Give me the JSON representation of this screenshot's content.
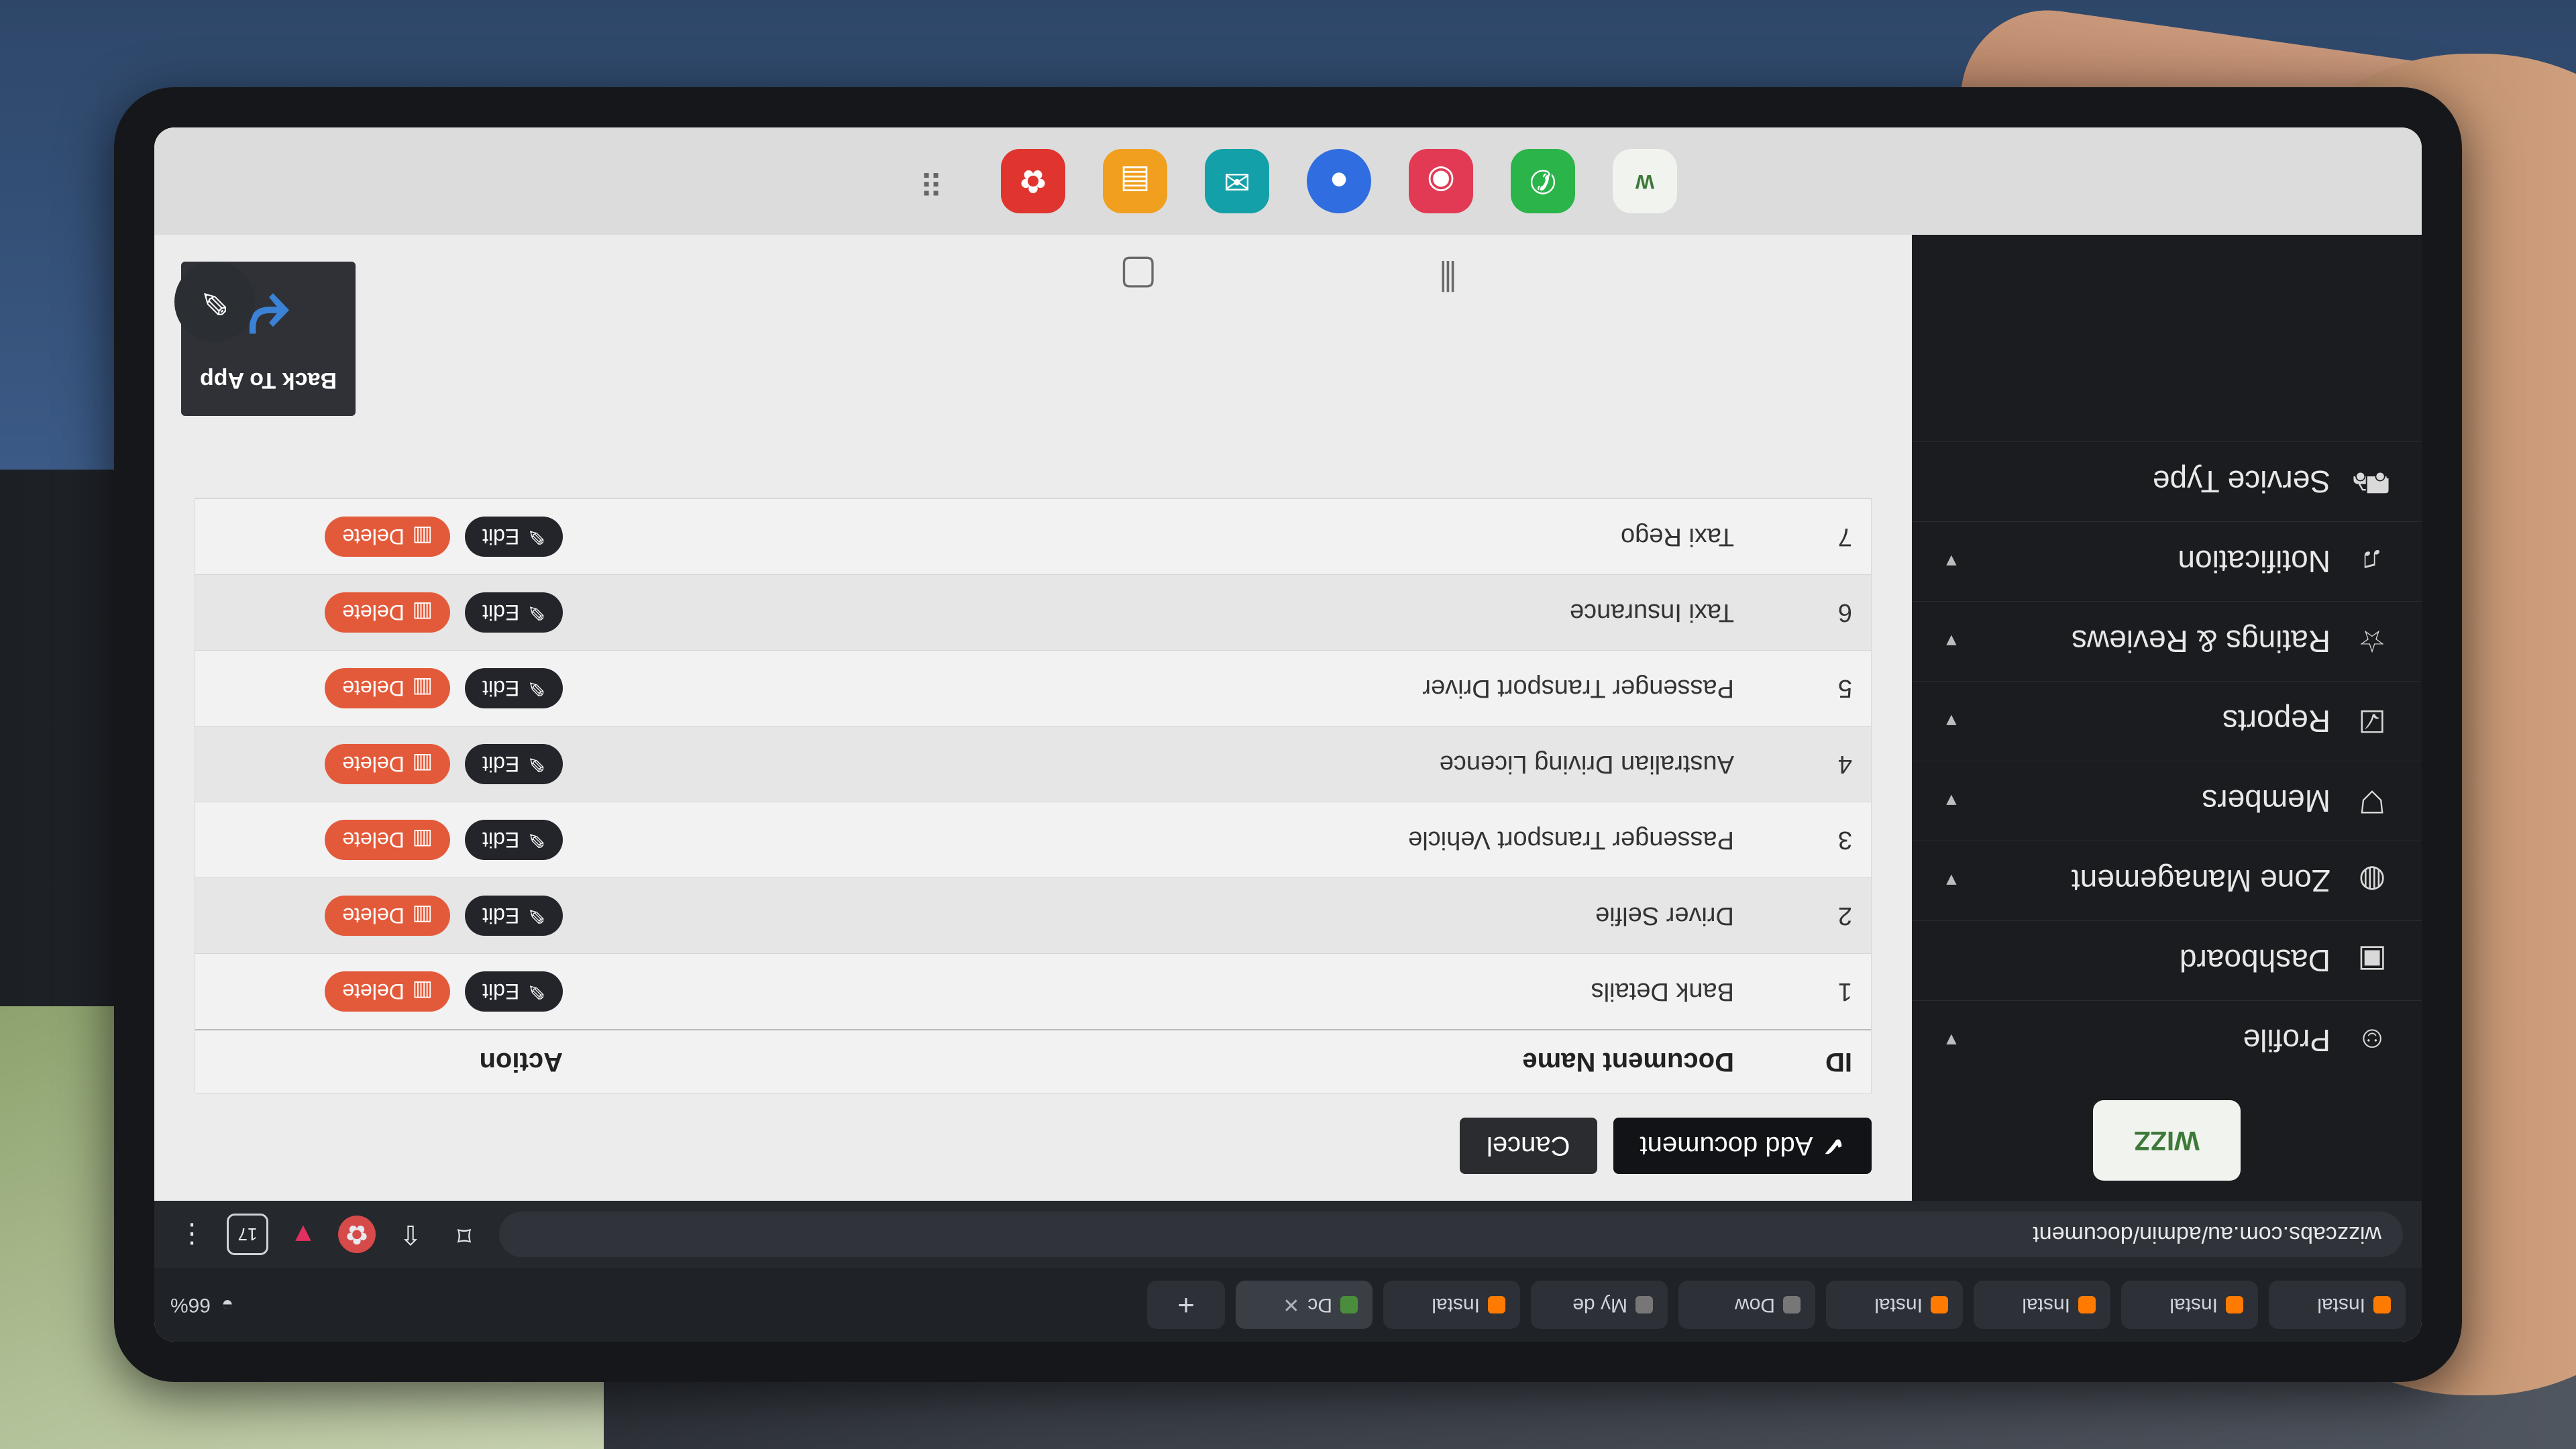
{
  "browser": {
    "tabs": [
      {
        "label": "Instal"
      },
      {
        "label": "Instal"
      },
      {
        "label": "Instal"
      },
      {
        "label": "Instal"
      },
      {
        "label": "Dow"
      },
      {
        "label": "My de"
      },
      {
        "label": "Instal"
      },
      {
        "label": "Dc"
      }
    ],
    "status_battery": "66%",
    "address": "wizzcabs.com.au/admin/document",
    "tab_count": "17"
  },
  "sidebar": {
    "items": [
      {
        "label": "Profile",
        "icon": "user-icon"
      },
      {
        "label": "Dashboard",
        "icon": "dashboard-icon"
      },
      {
        "label": "Zone Management",
        "icon": "globe-icon"
      },
      {
        "label": "Members",
        "icon": "filter-icon"
      },
      {
        "label": "Reports",
        "icon": "report-icon"
      },
      {
        "label": "Ratings & Reviews",
        "icon": "star-icon"
      },
      {
        "label": "Notification",
        "icon": "bell-icon"
      },
      {
        "label": "Service Type",
        "icon": "car-icon"
      }
    ]
  },
  "main": {
    "add_label": "Add document",
    "cancel_label": "Cancel",
    "table": {
      "headers": {
        "id": "ID",
        "name": "Document Name",
        "action": "Action"
      },
      "rows": [
        {
          "id": "1",
          "name": "Bank Details"
        },
        {
          "id": "2",
          "name": "Driver Selfie"
        },
        {
          "id": "3",
          "name": "Passenger Transport Vehicle"
        },
        {
          "id": "4",
          "name": "Australian Driving Licence"
        },
        {
          "id": "5",
          "name": "Passenger Transport Driver"
        },
        {
          "id": "6",
          "name": "Taxi Insurance"
        },
        {
          "id": "7",
          "name": "Taxi Rego"
        }
      ],
      "edit_label": "Edit",
      "delete_label": "Delete"
    },
    "back_to_app": "Back To App"
  },
  "dock": {
    "apps": [
      {
        "name": "wizz",
        "color": "#f1f3ee"
      },
      {
        "name": "phone-app",
        "color": "#2bb44a"
      },
      {
        "name": "camera-app",
        "color": "#e23a55"
      },
      {
        "name": "bixby-app",
        "color": "#2f6de0"
      },
      {
        "name": "messages-app",
        "color": "#14a0a8"
      },
      {
        "name": "notes-app",
        "color": "#f0a01e"
      },
      {
        "name": "gallery-app",
        "color": "#e0342f"
      }
    ]
  }
}
